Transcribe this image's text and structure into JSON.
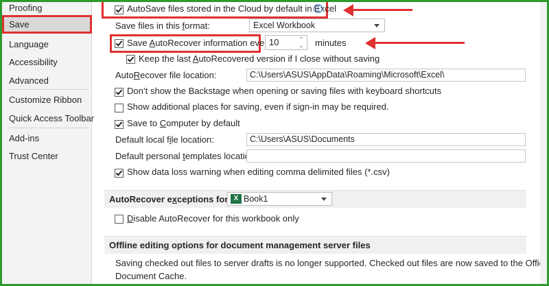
{
  "sidebar": {
    "items": [
      {
        "label": "Proofing"
      },
      {
        "label": "Save"
      },
      {
        "label": "Language"
      },
      {
        "label": "Accessibility"
      },
      {
        "label": "Advanced"
      },
      {
        "label": "Customize Ribbon"
      },
      {
        "label": "Quick Access Toolbar"
      },
      {
        "label": "Add-ins"
      },
      {
        "label": "Trust Center"
      }
    ],
    "selected": "Save"
  },
  "save": {
    "autosave_cloud": {
      "label": "AutoSave files stored in the Cloud by default in Excel",
      "checked": true
    },
    "format_label": "Save files in this format:",
    "format_value": "Excel Workbook",
    "autorecover_every": {
      "label": "Save AutoRecover information every",
      "checked": true
    },
    "autorecover_minutes": "10",
    "minutes_label": "minutes",
    "keep_last": {
      "label": "Keep the last AutoRecovered version if I close without saving",
      "checked": true
    },
    "autorecover_location_label": "AutoRecover file location:",
    "autorecover_location_value": "C:\\Users\\ASUS\\AppData\\Roaming\\Microsoft\\Excel\\",
    "dont_show_backstage": {
      "label": "Don’t show the Backstage when opening or saving files with keyboard shortcuts",
      "checked": true
    },
    "show_additional_places": {
      "label": "Show additional places for saving, even if sign-in may be required.",
      "checked": false
    },
    "save_to_computer": {
      "label": "Save to Computer by default",
      "checked": true
    },
    "default_local_label": "Default local file location:",
    "default_local_value": "C:\\Users\\ASUS\\Documents",
    "default_templates_label": "Default personal templates location:",
    "default_templates_value": "",
    "data_loss_warning": {
      "label": "Show data loss warning when editing comma delimited files (*.csv)",
      "checked": true
    }
  },
  "exceptions": {
    "header_label": "AutoRecover exceptions for:",
    "workbook": "Book1",
    "disable_autorecover": {
      "label": "Disable AutoRecover for this workbook only",
      "checked": false
    }
  },
  "offline": {
    "header": "Offline editing options for document management server files",
    "text_line1": "Saving checked out files to server drafts is no longer supported. Checked out files are now saved to the Office",
    "text_line2": "Document Cache."
  },
  "colors": {
    "annotation_red": "#e03030",
    "frame_green": "#2e9a2e",
    "sidebar_bg": "#f3f3f3",
    "section_bg": "#f0f0f0"
  }
}
